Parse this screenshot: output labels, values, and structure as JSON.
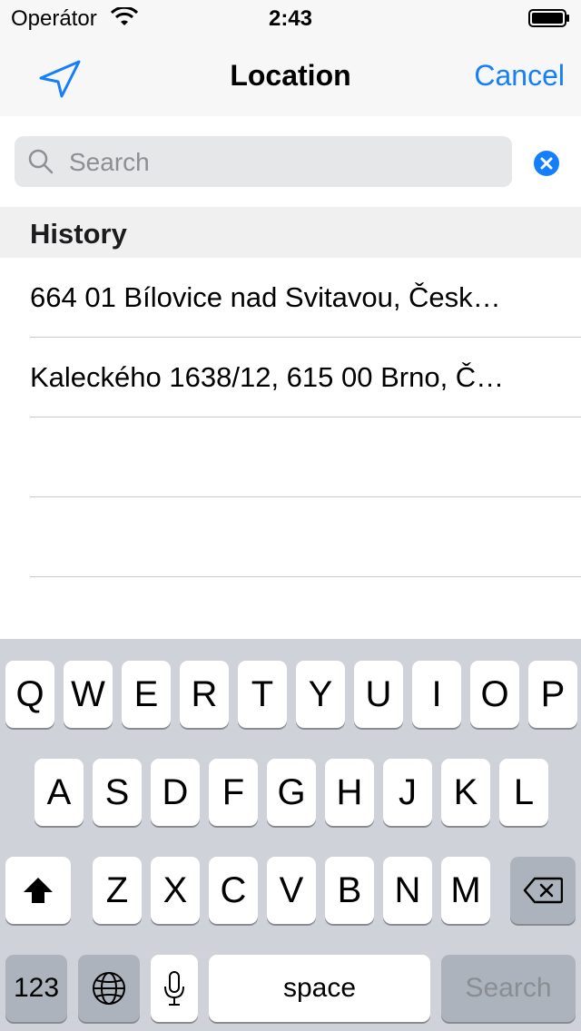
{
  "status": {
    "carrier": "Operátor",
    "time": "2:43"
  },
  "nav": {
    "title": "Location",
    "cancel": "Cancel",
    "accent": "#157efb"
  },
  "search": {
    "placeholder": "Search",
    "value": ""
  },
  "history": {
    "header": "History",
    "items": [
      "664 01 Bílovice nad Svitavou, Česk…",
      "Kaleckého 1638/12, 615 00 Brno, Č…",
      "",
      ""
    ]
  },
  "keyboard": {
    "row1": [
      "Q",
      "W",
      "E",
      "R",
      "T",
      "Y",
      "U",
      "I",
      "O",
      "P"
    ],
    "row2": [
      "A",
      "S",
      "D",
      "F",
      "G",
      "H",
      "J",
      "K",
      "L"
    ],
    "row3": [
      "Z",
      "X",
      "C",
      "V",
      "B",
      "N",
      "M"
    ],
    "numbers": "123",
    "space": "space",
    "search": "Search",
    "icons": [
      "shift-icon",
      "backspace-icon",
      "globe-icon",
      "microphone-icon"
    ]
  }
}
